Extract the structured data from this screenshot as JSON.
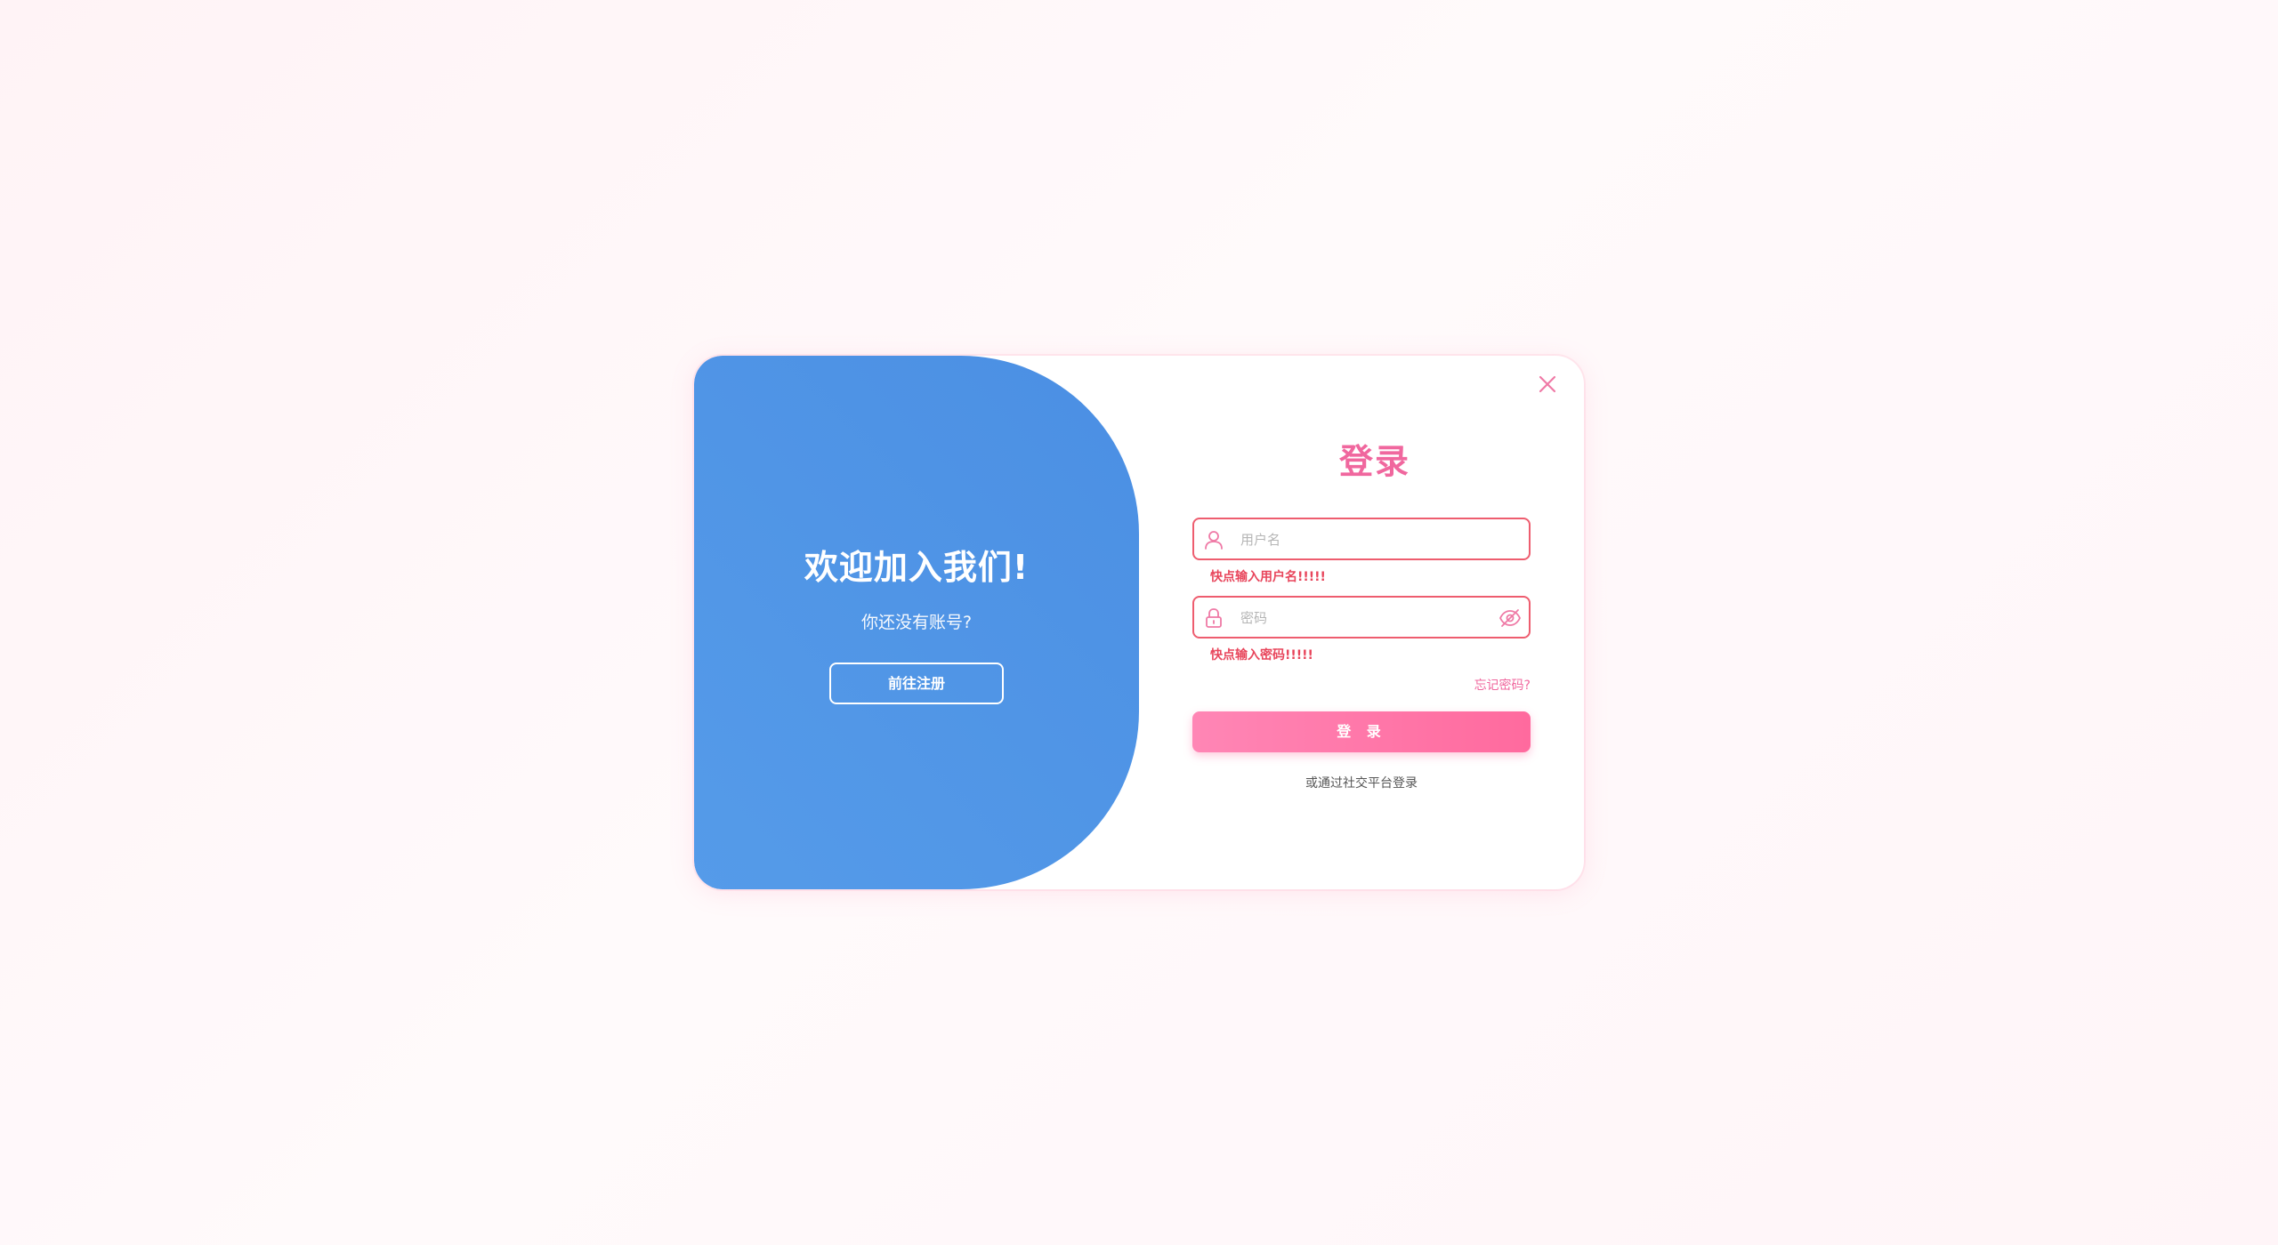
{
  "welcome": {
    "title": "欢迎加入我们!",
    "subtitle": "你还没有账号?",
    "register_button": "前往注册"
  },
  "login": {
    "title": "登录",
    "username_placeholder": "用户名",
    "username_error": "快点输入用户名!!!!!",
    "password_placeholder": "密码",
    "password_error": "快点输入密码!!!!!",
    "forgot_password": "忘记密码?",
    "submit_button": "登 录",
    "social_text": "或通过社交平台登录"
  },
  "icons": {
    "close": "close-icon",
    "user": "user-icon",
    "lock": "lock-icon",
    "eye_hidden": "eye-off-icon"
  },
  "colors": {
    "accent_pink": "#f0679e",
    "panel_blue": "#4b8fe3",
    "error_red": "#e8465c"
  }
}
